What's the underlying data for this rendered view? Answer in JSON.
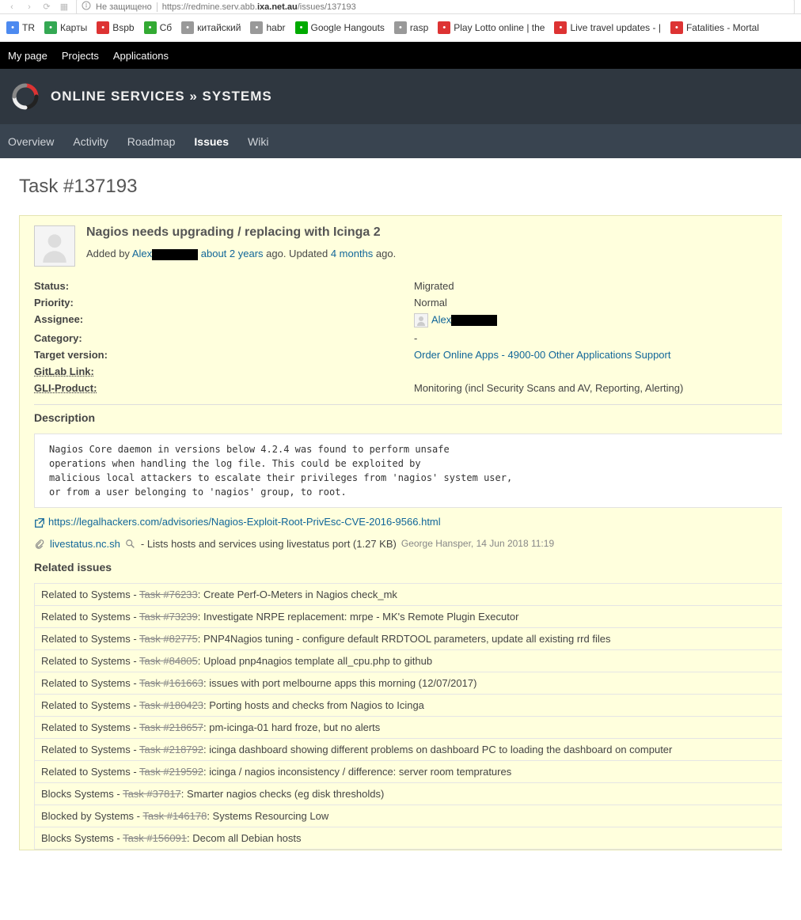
{
  "browser": {
    "secure_text": "Не защищено",
    "url_prefix": "https://redmine.serv.abb.",
    "url_bold": "ixa.net.au",
    "url_suffix": "/issues/137193"
  },
  "bookmarks": [
    {
      "label": "TR",
      "icon": "#4d8af0"
    },
    {
      "label": "Карты",
      "icon": "#34a853"
    },
    {
      "label": "Bspb",
      "icon": "#d33"
    },
    {
      "label": "Сб",
      "icon": "#3a3"
    },
    {
      "label": "китайский",
      "icon": "#999"
    },
    {
      "label": "habr",
      "icon": "#999"
    },
    {
      "label": "Google Hangouts",
      "icon": "#0a0"
    },
    {
      "label": "rasp",
      "icon": "#999"
    },
    {
      "label": "Play Lotto online | the",
      "icon": "#d33"
    },
    {
      "label": "Live travel updates - |",
      "icon": "#d33"
    },
    {
      "label": "Fatalities - Mortal",
      "icon": "#d33"
    }
  ],
  "top_menu": [
    "My page",
    "Projects",
    "Applications"
  ],
  "header_title": "ONLINE SERVICES » SYSTEMS",
  "main_menu": [
    {
      "label": "Overview"
    },
    {
      "label": "Activity"
    },
    {
      "label": "Roadmap"
    },
    {
      "label": "Issues",
      "selected": true
    },
    {
      "label": "Wiki"
    }
  ],
  "page_title": "Task #137193",
  "issue": {
    "subject": "Nagios needs upgrading / replacing with Icinga 2",
    "added_by_prefix": "Added by ",
    "author_visible": "Alex",
    "created_ago": "about 2 years",
    "ago_text": " ago. Updated ",
    "updated_ago": "4 months",
    "ago_suffix": " ago."
  },
  "attrs": {
    "status_label": "Status:",
    "status": "Migrated",
    "priority_label": "Priority:",
    "priority": "Normal",
    "assignee_label": "Assignee:",
    "assignee": "Alex",
    "category_label": "Category:",
    "category": "-",
    "target_label": "Target version:",
    "target": "Order Online Apps - 4900-00 Other Applications Support",
    "gitlab_label": "GitLab Link:",
    "gli_label": "GLI-Product:",
    "gli": "Monitoring (incl Security Scans and AV, Reporting, Alerting)"
  },
  "description_heading": "Description",
  "description_body": "Nagios Core daemon in versions below 4.2.4 was found to perform unsafe\noperations when handling the log file. This could be exploited by\nmalicious local attackers to escalate their privileges from 'nagios' system user,\nor from a user belonging to 'nagios' group, to root.",
  "ext_link": "https://legalhackers.com/advisories/Nagios-Exploit-Root-PrivEsc-CVE-2016-9566.html",
  "attachment": {
    "name": "livestatus.nc.sh",
    "desc": " - Lists hosts and services using livestatus port (1.27 KB)",
    "meta": "George Hansper, 14 Jun 2018 11:19"
  },
  "related_heading": "Related issues",
  "related": [
    {
      "prefix": "Related to Systems - ",
      "task": "Task #76233",
      "desc": ": Create Perf-O-Meters in Nagios check_mk"
    },
    {
      "prefix": "Related to Systems - ",
      "task": "Task #73239",
      "desc": ": Investigate NRPE replacement: mrpe - MK's Remote Plugin Executor"
    },
    {
      "prefix": "Related to Systems - ",
      "task": "Task #82775",
      "desc": ": PNP4Nagios tuning - configure default RRDTOOL parameters, update all existing rrd files"
    },
    {
      "prefix": "Related to Systems - ",
      "task": "Task #84805",
      "desc": ": Upload pnp4nagios template all_cpu.php to github"
    },
    {
      "prefix": "Related to Systems - ",
      "task": "Task #161663",
      "desc": ": issues with port melbourne apps this morning (12/07/2017)"
    },
    {
      "prefix": "Related to Systems - ",
      "task": "Task #180423",
      "desc": ": Porting hosts and checks from Nagios to Icinga"
    },
    {
      "prefix": "Related to Systems - ",
      "task": "Task #218657",
      "desc": ": pm-icinga-01 hard froze, but no alerts"
    },
    {
      "prefix": "Related to Systems - ",
      "task": "Task #218792",
      "desc": ": icinga dashboard showing different problems on dashboard PC to loading the dashboard on computer"
    },
    {
      "prefix": "Related to Systems - ",
      "task": "Task #219592",
      "desc": ": icinga / nagios inconsistency / difference: server room tempratures"
    },
    {
      "prefix": "Blocks Systems - ",
      "task": "Task #37817",
      "desc": ": Smarter nagios checks (eg disk thresholds)"
    },
    {
      "prefix": "Blocked by Systems - ",
      "task": "Task #146178",
      "desc": ": Systems Resourcing Low"
    },
    {
      "prefix": "Blocks Systems - ",
      "task": "Task #156091",
      "desc": ": Decom all Debian hosts"
    }
  ]
}
